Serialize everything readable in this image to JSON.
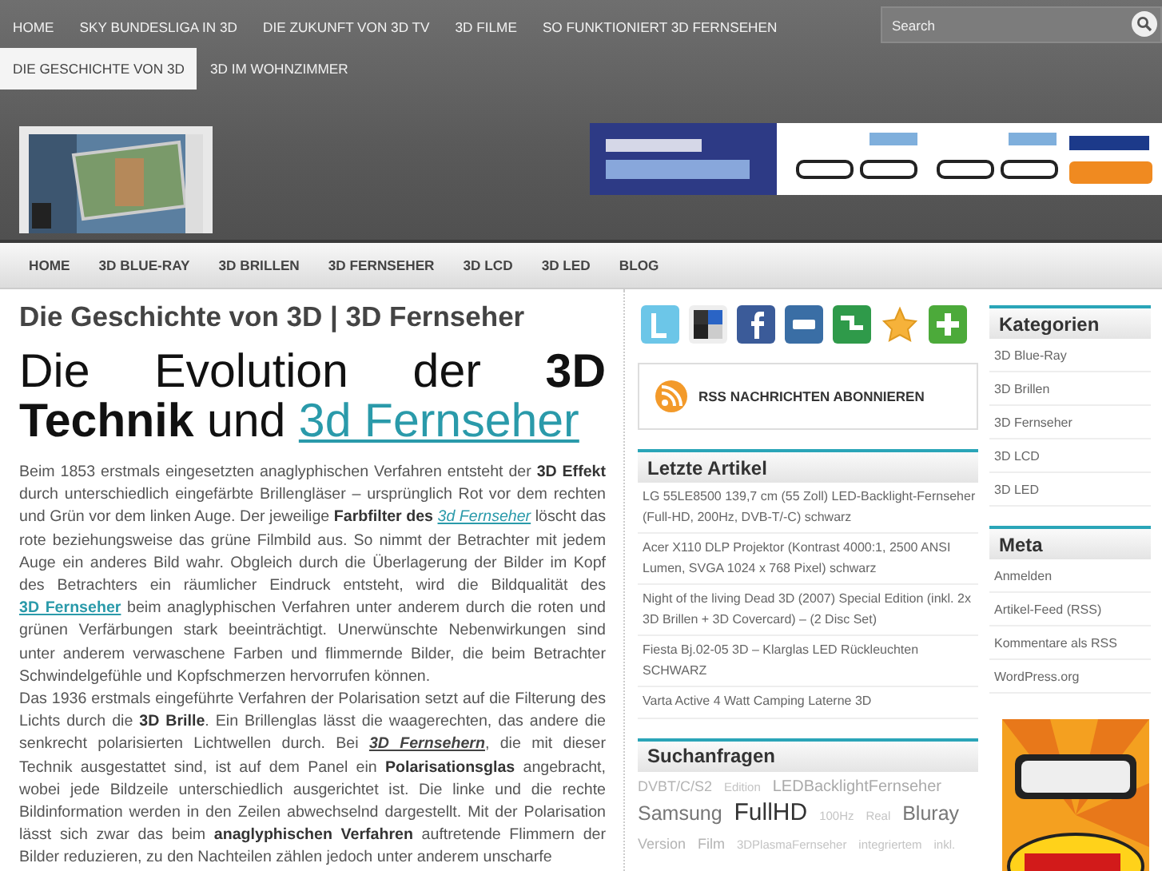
{
  "top_nav": {
    "items": [
      {
        "label": "HOME",
        "selected": false
      },
      {
        "label": "SKY BUNDESLIGA IN 3D",
        "selected": false
      },
      {
        "label": "DIE ZUKUNFT VON 3D TV",
        "selected": false
      },
      {
        "label": "3D FILME",
        "selected": false
      },
      {
        "label": "SO FUNKTIONIERT 3D FERNSEHEN",
        "selected": false
      },
      {
        "label": "DIE GESCHICHTE VON 3D",
        "selected": true
      },
      {
        "label": "3D IM WOHNZIMMER",
        "selected": false
      }
    ],
    "search": {
      "placeholder": "Search"
    }
  },
  "category_nav": [
    "HOME",
    "3D BLUE-RAY",
    "3D BRILLEN",
    "3D FERNSEHER",
    "3D LCD",
    "3D LED",
    "BLOG"
  ],
  "article": {
    "title": "Die Geschichte von 3D | 3D Fernseher",
    "headline": {
      "text": "Die Evolution der **3D Technik** und",
      "link": "3d Fernseher"
    },
    "paragraphs": [
      [
        {
          "kind": "text",
          "text": "Beim 1853 erstmals eingesetzten anaglyphischen Verfahren entsteht der **3D Effekt** durch unterschiedlich eingefärbte Brillengläser – ursprünglich Rot vor dem rechten und Grün vor dem linken Auge. Der jeweilige **Farbfilter des** "
        },
        {
          "kind": "emlink",
          "text": "3d Fernseher"
        },
        {
          "kind": "text",
          "text": " löscht das rote beziehungsweise das grüne Filmbild aus. So nimmt der Betrachter mit jedem Auge ein anderes Bild wahr. Obgleich durch die Überlagerung der Bilder im Kopf des Betrachters ein räumlicher Eindruck entsteht, wird die Bildqualität des "
        },
        {
          "kind": "stronglink",
          "text": "3D Fernseher"
        },
        {
          "kind": "text",
          "text": " beim anaglyphischen Verfahren unter anderem durch die roten und grünen Verfärbungen stark beeinträchtigt. Unerwünschte Nebenwirkungen sind unter anderem verwaschene Farben und flimmernde Bilder, die beim Betrachter Schwindelgefühle und Kopfschmerzen hervorrufen können."
        }
      ],
      [
        {
          "kind": "text",
          "text": "Das 1936 erstmals eingeführte Verfahren der Polarisation setzt auf die Filterung des Lichts durch die **3D Brille**. Ein Brillenglas lässt die waagerechten, das andere die senkrecht polarisierten Lichtwellen durch. Bei "
        },
        {
          "kind": "darklink",
          "text": "3D Fernsehern"
        },
        {
          "kind": "text",
          "text": ", die mit dieser Technik ausgestattet sind, ist auf dem Panel ein **Polarisationsglas** angebracht, wobei jede Bildzeile unterschiedlich ausgerichtet ist. Die linke und die rechte Bildinformation werden in den Zeilen abwechselnd dargestellt. Mit der Polarisation lässt sich zwar das beim **anaglyphischen Verfahren** auftretende Flimmern der Bilder reduzieren, zu den Nachteilen zählen jedoch unter anderem unscharfe"
        }
      ]
    ]
  },
  "share_icons": [
    {
      "kind": "bird"
    },
    {
      "kind": "squares"
    },
    {
      "kind": "fb"
    },
    {
      "kind": "digg"
    },
    {
      "kind": "stumble"
    },
    {
      "kind": "star"
    },
    {
      "kind": "plus"
    }
  ],
  "rss": {
    "label": "RSS NACHRICHTEN ABONNIEREN"
  },
  "recent": {
    "title": "Letzte Artikel",
    "items": [
      "LG 55LE8500 139,7 cm (55 Zoll) LED-Backlight-Fernseher (Full-HD, 200Hz, DVB-T/-C) schwarz",
      "Acer X110 DLP Projektor (Kontrast 4000:1, 2500 ANSI Lumen, SVGA 1024 x 768 Pixel) schwarz",
      "Night of the living Dead 3D (2007) Special Edition (inkl. 2x 3D Brillen + 3D Covercard) – (2 Disc Set)",
      "Fiesta Bj.02-05 3D – Klarglas LED Rückleuchten SCHWARZ",
      "Varta Active 4 Watt Camping Laterne 3D"
    ]
  },
  "searches": {
    "title": "Suchanfragen",
    "tags": [
      {
        "text": "DVBT/C/S2",
        "kind": "small"
      },
      {
        "text": "Edition",
        "kind": "tiny"
      },
      {
        "text": "LEDBacklightFernseher",
        "kind": "medium"
      },
      {
        "text": "Samsung",
        "kind": "large"
      },
      {
        "text": "FullHD",
        "kind": "huge"
      },
      {
        "text": "100Hz",
        "kind": "tiny"
      },
      {
        "text": "Real",
        "kind": "tiny"
      },
      {
        "text": "Bluray",
        "kind": "large"
      },
      {
        "text": "Version",
        "kind": "small"
      },
      {
        "text": "Film",
        "kind": "small"
      },
      {
        "text": "3DPlasmaFernseher",
        "kind": "tiny"
      },
      {
        "text": "integriertem",
        "kind": "tiny"
      },
      {
        "text": "inkl.",
        "kind": "tiny"
      }
    ]
  },
  "categories": {
    "title": "Kategorien",
    "items": [
      "3D Blue-Ray",
      "3D Brillen",
      "3D Fernseher",
      "3D LCD",
      "3D LED"
    ]
  },
  "meta": {
    "title": "Meta",
    "items": [
      "Anmelden",
      "Artikel-Feed (RSS)",
      "Kommentare als RSS",
      "WordPress.org"
    ]
  }
}
